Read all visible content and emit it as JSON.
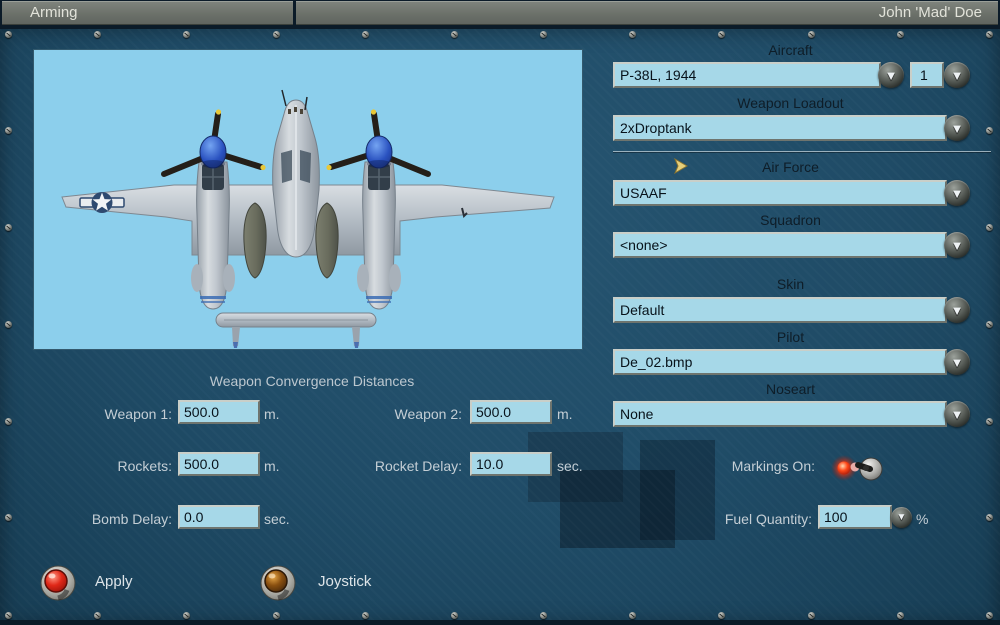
{
  "title_bar": {
    "screen": "Arming",
    "player": "John 'Mad' Doe"
  },
  "panel": {
    "aircraft": {
      "label": "Aircraft",
      "value": "P-38L, 1944",
      "count": "1"
    },
    "loadout": {
      "label": "Weapon Loadout",
      "value": "2xDroptank"
    },
    "airforce": {
      "label": "Air Force",
      "value": "USAAF"
    },
    "squadron": {
      "label": "Squadron",
      "value": "<none>"
    },
    "skin": {
      "label": "Skin",
      "value": "Default"
    },
    "pilot": {
      "label": "Pilot",
      "value": "De_02.bmp"
    },
    "noseart": {
      "label": "Noseart",
      "value": "None"
    }
  },
  "convergence": {
    "title": "Weapon Convergence Distances",
    "weapon1": {
      "label": "Weapon 1:",
      "value": "500.0",
      "unit": "m."
    },
    "weapon2": {
      "label": "Weapon 2:",
      "value": "500.0",
      "unit": "m."
    },
    "rockets": {
      "label": "Rockets:",
      "value": "500.0",
      "unit": "m."
    },
    "rocket_delay": {
      "label": "Rocket Delay:",
      "value": "10.0",
      "unit": "sec."
    },
    "bomb_delay": {
      "label": "Bomb Delay:",
      "value": "0.0",
      "unit": "sec."
    }
  },
  "options": {
    "markings": {
      "label": "Markings On:",
      "state": "on"
    },
    "fuel": {
      "label": "Fuel Quantity:",
      "value": "100",
      "unit": "%"
    }
  },
  "actions": {
    "apply": "Apply",
    "joystick": "Joystick"
  },
  "icons": {
    "dropdown_arrow": "▼"
  },
  "colors": {
    "background": "#1f4b66",
    "titlebar": "#6e736c",
    "field_blue": "#a6d8e8",
    "preview_sky": "#8ccfec",
    "apply_button_red": "#e02818",
    "joystick_button_amber": "#8a5010",
    "markings_light_red": "#ff3818"
  }
}
